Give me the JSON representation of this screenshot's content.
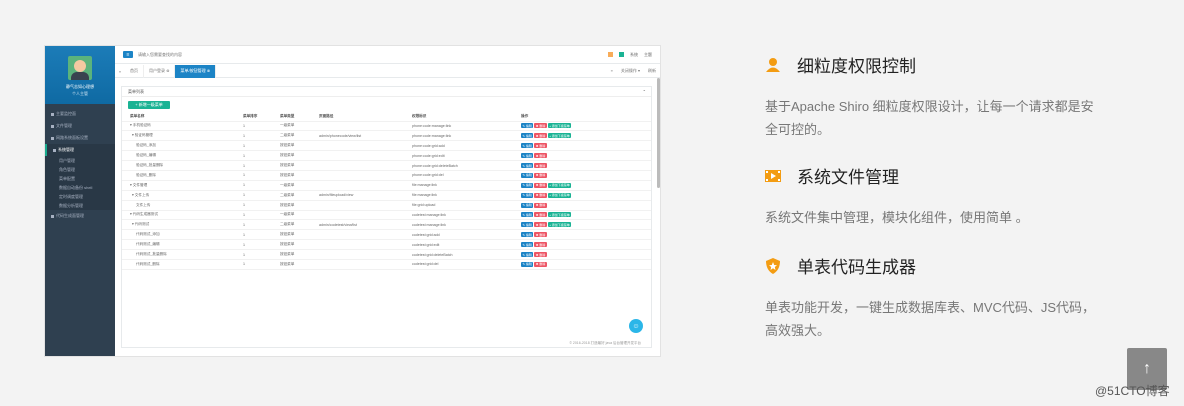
{
  "admin": {
    "profile": {
      "name": "静气志如心理想",
      "role": "个人主管"
    },
    "sidebar_items": [
      {
        "label": "主要监控面"
      },
      {
        "label": "文件管理"
      },
      {
        "label": "网路系统面板设置"
      },
      {
        "label": "系统管理",
        "active": true
      }
    ],
    "sidebar_sub_items": [
      "用户管理",
      "角色管理",
      "菜单配置",
      "数据自动备份 shell",
      "定时调度管理",
      "数据分析管理"
    ],
    "sidebar_last_item": "代码生成面管理",
    "topbar": {
      "menu_icon": "≡",
      "search_placeholder": "请输入您需要查找的内容",
      "user": "系统",
      "logout": "主题"
    },
    "tabs": [
      "首页",
      "用户登录 ⊗",
      "菜单/按钮管理 ⊗"
    ],
    "tabs_right": [
      "关闭操作 ▾",
      "刷新"
    ],
    "panel_title": "菜单列表",
    "add_button": "+ 新增一级菜单",
    "columns": [
      "菜单名称",
      "菜单排序",
      "菜单类型",
      "页面路径",
      "权限标识",
      "操作"
    ],
    "rows": [
      {
        "name": "▾ 手机验证码",
        "sort": "1",
        "type": "一级菜单",
        "path": "",
        "perm": "phone:code:manage:link",
        "ops": [
          "edit",
          "del",
          "add"
        ]
      },
      {
        "name": "  ▾ 验证码管理",
        "sort": "1",
        "type": "二级菜单",
        "path": "admin/phonecode/view/list",
        "perm": "phone:code:manage:link",
        "ops": [
          "edit",
          "del",
          "add"
        ]
      },
      {
        "name": "      验证码_添加",
        "sort": "1",
        "type": "按钮菜单",
        "path": "",
        "perm": "phone:code:grid:add",
        "ops": [
          "edit",
          "del"
        ]
      },
      {
        "name": "      验证码_编辑",
        "sort": "1",
        "type": "按钮菜单",
        "path": "",
        "perm": "phone:code:grid:edit",
        "ops": [
          "edit",
          "del"
        ]
      },
      {
        "name": "      验证码_批量删除",
        "sort": "1",
        "type": "按钮菜单",
        "path": "",
        "perm": "phone:code:grid:deleteBatch",
        "ops": [
          "edit",
          "del"
        ]
      },
      {
        "name": "      验证码_删除",
        "sort": "1",
        "type": "按钮菜单",
        "path": "",
        "perm": "phone:code:grid:del",
        "ops": [
          "edit",
          "del"
        ]
      },
      {
        "name": "▾ 文件管理",
        "sort": "1",
        "type": "一级菜单",
        "path": "",
        "perm": "file:manage:link",
        "ops": [
          "edit",
          "del",
          "add"
        ]
      },
      {
        "name": "  ▾ 文件上传",
        "sort": "1",
        "type": "二级菜单",
        "path": "admin/fileupload/view",
        "perm": "file:manage:link",
        "ops": [
          "edit",
          "del",
          "add"
        ]
      },
      {
        "name": "      文件上传",
        "sort": "1",
        "type": "按钮菜单",
        "path": "",
        "perm": "file:grid:upload",
        "ops": [
          "edit",
          "del"
        ]
      },
      {
        "name": "▾ 代码生成器测试",
        "sort": "1",
        "type": "一级菜单",
        "path": "",
        "perm": "codetest:manage:link",
        "ops": [
          "edit",
          "del",
          "add"
        ]
      },
      {
        "name": "  ▾ 代码测试",
        "sort": "1",
        "type": "二级菜单",
        "path": "admin/codetest/view/list",
        "perm": "codetest:manage:link",
        "ops": [
          "edit",
          "del",
          "add"
        ]
      },
      {
        "name": "      代码测试_添加",
        "sort": "1",
        "type": "按钮菜单",
        "path": "",
        "perm": "codetest:grid:add",
        "ops": [
          "edit",
          "del"
        ]
      },
      {
        "name": "      代码测试_编辑",
        "sort": "1",
        "type": "按钮菜单",
        "path": "",
        "perm": "codetest:grid:edit",
        "ops": [
          "edit",
          "del"
        ]
      },
      {
        "name": "      代码测试_批量删除",
        "sort": "1",
        "type": "按钮菜单",
        "path": "",
        "perm": "codetest:grid:deleteBatch",
        "ops": [
          "edit",
          "del"
        ]
      },
      {
        "name": "      代码测试_删除",
        "sort": "1",
        "type": "按钮菜单",
        "path": "",
        "perm": "codetest:grid:del",
        "ops": [
          "edit",
          "del"
        ]
      }
    ],
    "op_labels": {
      "edit": "✎ 编辑",
      "del": "✖ 删除",
      "add": "+ 添加下级菜单"
    },
    "footer": "© 2016-2018 打造最好 java 后台管理开发平台",
    "float_icon": "☺"
  },
  "features": [
    {
      "icon": "user-icon",
      "title": "细粒度权限控制",
      "desc": "基于Apache Shiro 细粒度权限设计，让每一个请求都是安全可控的。"
    },
    {
      "icon": "film-icon",
      "title": "系统文件管理",
      "desc": "系统文件集中管理，模块化组件，使用简单 。"
    },
    {
      "icon": "shield-icon",
      "title": "单表代码生成器",
      "desc": "单表功能开发，一键生成数据库表、MVC代码、JS代码，高效强大。"
    }
  ],
  "colors": {
    "accent": "#f39c12",
    "sidebar": "#2f4050",
    "primary": "#1c84c6",
    "success": "#1ab394",
    "danger": "#ed5565"
  },
  "back_to_top": "↑",
  "watermark": "@51CTO博客"
}
